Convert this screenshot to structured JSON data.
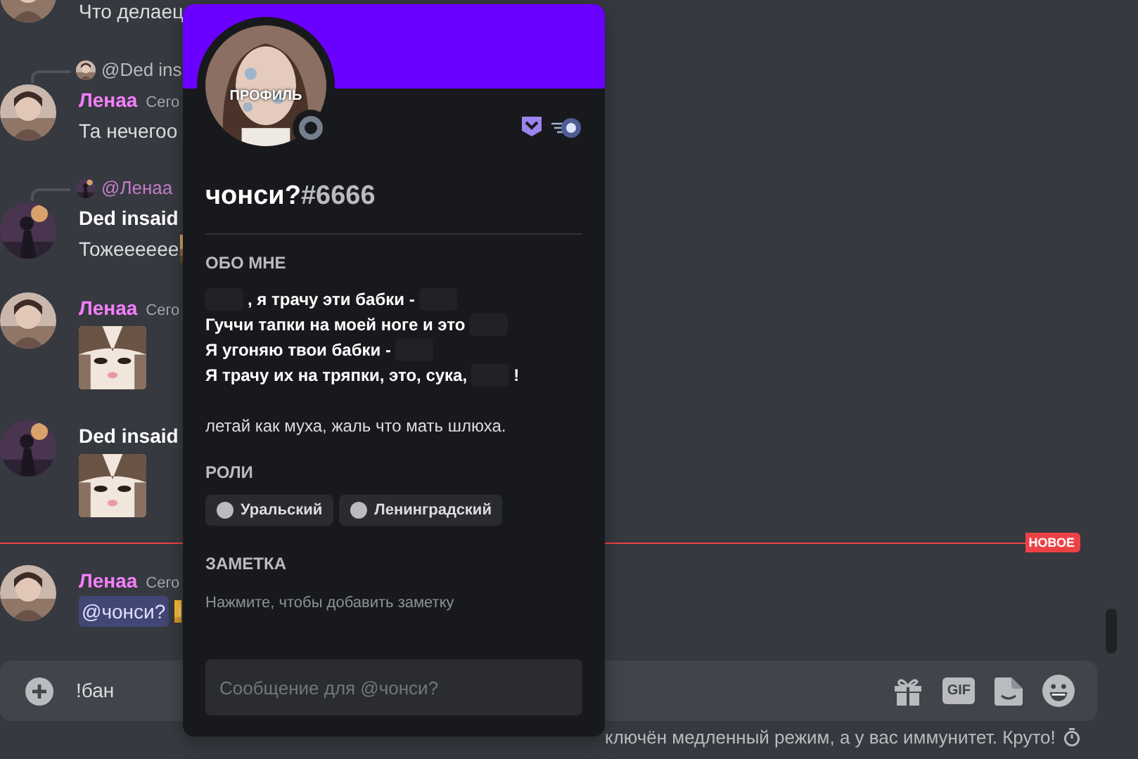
{
  "messages": [
    {
      "kind": "continuation",
      "text": "Что делаец"
    },
    {
      "kind": "text",
      "reply": {
        "author": "@Ded ins",
        "color": "#b9bbbe"
      },
      "author": "Ленаа",
      "color": "#f47fff",
      "time": "Сего",
      "text": "Та нечегоо"
    },
    {
      "kind": "text",
      "reply": {
        "author": "@Ленаа",
        "color": "#c27ec9"
      },
      "author": "Ded insaid",
      "color": "#ffffff",
      "text": "Тожееееее",
      "emoji": true
    },
    {
      "author": "Ленаа",
      "color": "#f47fff",
      "time": "Сего"
    },
    {
      "author": "Ded insaid",
      "color": "#ffffff"
    },
    {
      "kind": "divider",
      "label": "НОВОЕ"
    },
    {
      "kind": "mention",
      "author": "Ленаа",
      "color": "#f47fff",
      "time": "Сего",
      "mention": "@чонси?",
      "emoji": true
    }
  ],
  "composer": {
    "value": "!бан",
    "buttons": [
      {
        "kind": "gift"
      },
      {
        "kind": "gif",
        "label": "GIF"
      },
      {
        "kind": "sticker"
      },
      {
        "kind": "emoji"
      }
    ]
  },
  "slowmode_notice": "ключён медленный режим, а у вас иммунитет. Круто!",
  "profile": {
    "avatar_overlay": "ПРОФИЛЬ",
    "username": "чонси?",
    "discriminator": "#6666",
    "about_title": "ОБО МНЕ",
    "bio_lines": [
      {
        "bold": true,
        "parts": [
          {
            "kind": "spoiler"
          },
          {
            "kind": "text",
            "text": ", я трачу эти бабки -"
          },
          {
            "kind": "spoiler"
          }
        ]
      },
      {
        "bold": true,
        "parts": [
          {
            "kind": "text",
            "text": "Гуччи тапки на моей ноге и это"
          },
          {
            "kind": "spoiler"
          }
        ]
      },
      {
        "bold": true,
        "parts": [
          {
            "kind": "text",
            "text": "Я угоняю твои бабки -"
          },
          {
            "kind": "spoiler"
          }
        ]
      },
      {
        "bold": true,
        "parts": [
          {
            "kind": "text",
            "text": "Я трачу их на тряпки, это, сука,"
          },
          {
            "kind": "spoiler"
          },
          {
            "kind": "text",
            "text": "!"
          }
        ]
      },
      {
        "bold": false,
        "parts": [
          {
            "kind": "text",
            "text": "летай как муха, жаль что мать шлюха."
          }
        ]
      }
    ],
    "roles_title": "РОЛИ",
    "roles": [
      {
        "name": "Уральский",
        "color": "#b9bbbe"
      },
      {
        "name": "Ленинградский",
        "color": "#b9bbbe"
      }
    ],
    "note_title": "ЗАМЕТКА",
    "note_placeholder": "Нажмите, чтобы добавить заметку",
    "message_placeholder": "Сообщение для @чонси?"
  }
}
